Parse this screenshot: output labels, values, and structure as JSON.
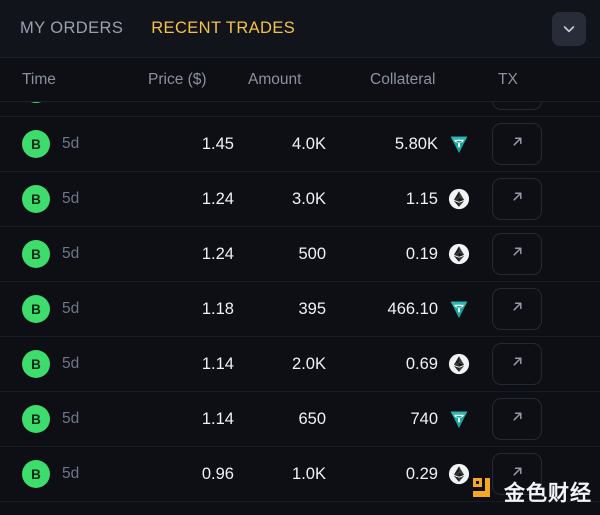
{
  "tabs": [
    {
      "label": "MY ORDERS",
      "active": false
    },
    {
      "label": "RECENT TRADES",
      "active": true
    }
  ],
  "header_controls": {
    "collapse_icon": "chevron-down-icon"
  },
  "table": {
    "columns": [
      {
        "key": "time",
        "label": "Time"
      },
      {
        "key": "price",
        "label": "Price ($)"
      },
      {
        "key": "amount",
        "label": "Amount"
      },
      {
        "key": "collateral",
        "label": "Collateral"
      },
      {
        "key": "tx",
        "label": "TX"
      }
    ],
    "rows": [
      {
        "side": "B",
        "time": "",
        "price": "",
        "amount": "",
        "collateral": "",
        "collateral_token": "",
        "tx_icon": "external-link-icon",
        "clipped": true
      },
      {
        "side": "B",
        "time": "5d",
        "price": "1.45",
        "amount": "4.0K",
        "collateral": "5.80K",
        "collateral_token": "usdt",
        "tx_icon": "external-link-icon",
        "clipped": false
      },
      {
        "side": "B",
        "time": "5d",
        "price": "1.24",
        "amount": "3.0K",
        "collateral": "1.15",
        "collateral_token": "eth",
        "tx_icon": "external-link-icon",
        "clipped": false
      },
      {
        "side": "B",
        "time": "5d",
        "price": "1.24",
        "amount": "500",
        "collateral": "0.19",
        "collateral_token": "eth",
        "tx_icon": "external-link-icon",
        "clipped": false
      },
      {
        "side": "B",
        "time": "5d",
        "price": "1.18",
        "amount": "395",
        "collateral": "466.10",
        "collateral_token": "usdt",
        "tx_icon": "external-link-icon",
        "clipped": false
      },
      {
        "side": "B",
        "time": "5d",
        "price": "1.14",
        "amount": "2.0K",
        "collateral": "0.69",
        "collateral_token": "eth",
        "tx_icon": "external-link-icon",
        "clipped": false
      },
      {
        "side": "B",
        "time": "5d",
        "price": "1.14",
        "amount": "650",
        "collateral": "740",
        "collateral_token": "usdt",
        "tx_icon": "external-link-icon",
        "clipped": false
      },
      {
        "side": "B",
        "time": "5d",
        "price": "0.96",
        "amount": "1.0K",
        "collateral": "0.29",
        "collateral_token": "eth",
        "tx_icon": "external-link-icon",
        "clipped": false
      }
    ]
  },
  "watermark": {
    "text": "金色财经",
    "mark_icon": "jinse-logo-icon",
    "mark_color": "#f5a623"
  },
  "colors": {
    "background": "#0d0f15",
    "tabbar_background": "#11141b",
    "active_tab": "#f4c24a",
    "inactive_tab": "#9aa0ae",
    "column_header": "#8b91a0",
    "value_text": "#eef1f6",
    "time_text": "#6f7687",
    "buy_badge": "#3ddc6d",
    "usdt": "#1ba4a0",
    "row_divider": "#171b23"
  }
}
